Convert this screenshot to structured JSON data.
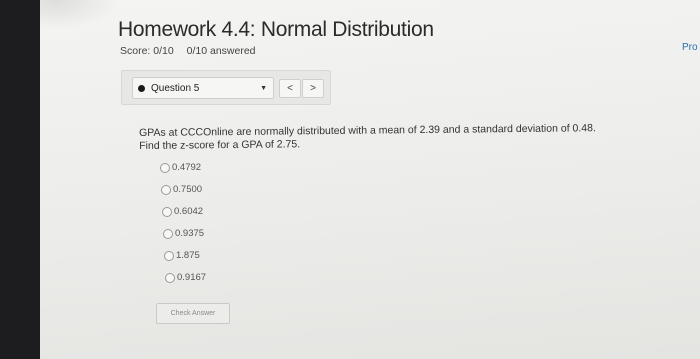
{
  "header": {
    "title": "Homework 4.4: Normal Distribution",
    "score": "Score: 0/10",
    "answered": "0/10 answered",
    "pro_link": "Pro"
  },
  "question_nav": {
    "selected": "Question 5",
    "prev": "<",
    "next": ">"
  },
  "question": {
    "line1": "GPAs at CCCOnline are normally distributed with a mean of 2.39 and a standard deviation of 0.48.",
    "line2": "Find the z-score for a GPA of 2.75."
  },
  "options": [
    "0.4792",
    "0.7500",
    "0.6042",
    "0.9375",
    "1.875",
    "0.9167"
  ],
  "actions": {
    "check_answer": "Check Answer"
  }
}
